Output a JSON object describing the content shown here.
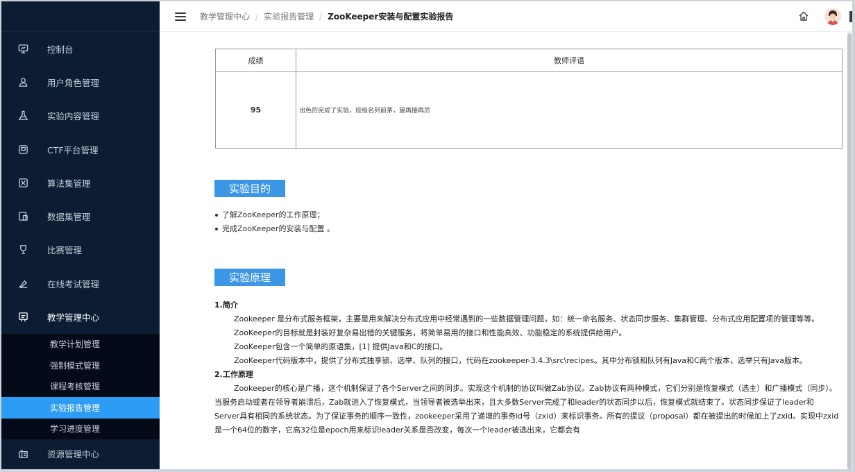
{
  "sidebar": {
    "items": [
      {
        "label": "控制台",
        "icon": "monitor-icon"
      },
      {
        "label": "用户角色管理",
        "icon": "user-icon"
      },
      {
        "label": "实验内容管理",
        "icon": "flask-icon"
      },
      {
        "label": "CTF平台管理",
        "icon": "ctf-icon"
      },
      {
        "label": "算法集管理",
        "icon": "algorithm-icon"
      },
      {
        "label": "数据集管理",
        "icon": "dataset-icon"
      },
      {
        "label": "比赛管理",
        "icon": "trophy-icon"
      },
      {
        "label": "在线考试管理",
        "icon": "exam-icon"
      },
      {
        "label": "教学管理中心",
        "icon": "teaching-icon"
      }
    ],
    "subitems": [
      {
        "label": "教学计划管理"
      },
      {
        "label": "强制模式管理"
      },
      {
        "label": "课程考核管理"
      },
      {
        "label": "实验报告管理"
      },
      {
        "label": "学习进度管理"
      }
    ],
    "last_item": {
      "label": "资源管理中心",
      "icon": "resource-icon"
    }
  },
  "header": {
    "breadcrumb": [
      "教学管理中心",
      "实验报告管理",
      "ZooKeeper安装与配置实验报告"
    ],
    "separator": "/"
  },
  "grade_table": {
    "col_score": "成绩",
    "col_comment": "教师评语",
    "score": "95",
    "comment": "出色的完成了实验，班级名列前茅，望再接再厉"
  },
  "sections": {
    "purpose_title": "实验目的",
    "purpose_items": [
      "了解ZooKeeper的工作原理；",
      "完成ZooKeeper的安装与配置 。"
    ],
    "principle_title": "实验原理"
  },
  "article": {
    "h1": "1.简介",
    "p1": "Zookeeper 是分布式服务框架，主要是用来解决分布式应用中经常遇到的一些数据管理问题，如：统一命名服务、状态同步服务、集群管理、分布式应用配置项的管理等等。",
    "p2": "ZooKeeper的目标就是封装好复杂易出错的关键服务，将简单易用的接口和性能高效、功能稳定的系统提供给用户。",
    "p3": "ZooKeeper包含一个简单的原语集，[1] 提供Java和C的接口。",
    "p4": "ZooKeeper代码版本中，提供了分布式独享锁、选举、队列的接口，代码在zookeeper-3.4.3\\src\\recipes。其中分布锁和队列有Java和C两个版本，选举只有Java版本。",
    "h2": "2.工作原理",
    "p5": "Zookeeper的核心是广播，这个机制保证了各个Server之间的同步。实现这个机制的协议叫做Zab协议。Zab协议有两种模式，它们分别是恢复模式（选主）和广播模式（同步）。当服务启动或者在领导者崩溃后，Zab就进入了恢复模式，当领导者被选举出来，且大多数Server完成了和leader的状态同步以后，恢复模式就结束了。状态同步保证了leader和Server具有相同的系统状态。为了保证事务的顺序一致性，zookeeper采用了递增的事务id号（zxid）来标识事务。所有的提议（proposal）都在被提出的时候加上了zxid。实现中zxid是一个64位的数字，它高32位是epoch用来标识leader关系是否改变，每次一个leader被选出来，它都会有"
  }
}
